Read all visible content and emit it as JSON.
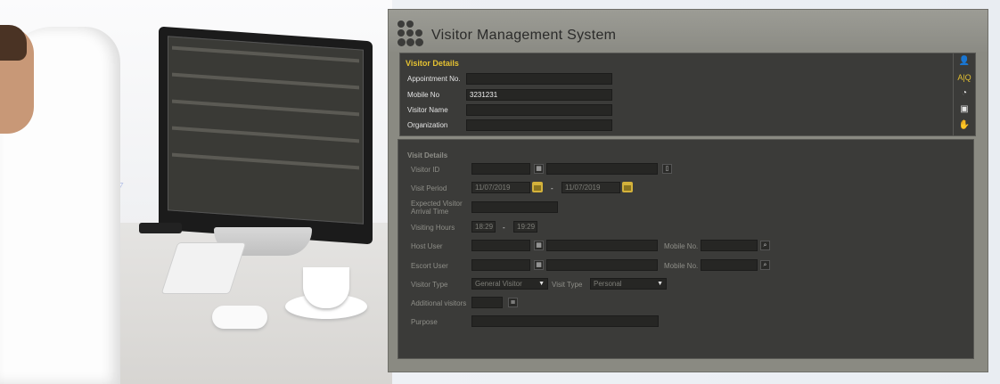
{
  "app": {
    "title": "Visitor Management System"
  },
  "visitor_details": {
    "heading": "Visitor Details",
    "appointment_label": "Appointment No.",
    "appointment_value": "",
    "mobile_label": "Mobile No",
    "mobile_value": "3231231",
    "name_label": "Visitor Name",
    "name_value": "",
    "org_label": "Organization",
    "org_value": ""
  },
  "visit_details": {
    "heading": "Visit Details",
    "visitor_id_label": "Visitor ID",
    "visit_period_label": "Visit Period",
    "period_from": "11/07/2019",
    "period_sep": "-",
    "period_to": "11/07/2019",
    "arrival_label_1": "Expected Visitor",
    "arrival_label_2": "Arrival Time",
    "hours_label": "Visiting Hours",
    "hours_from": "18:29",
    "hours_sep": "-",
    "hours_to": "19:29",
    "host_label": "Host User",
    "host_mobile_label": "Mobile No.",
    "escort_label": "Escort User",
    "escort_mobile_label": "Mobile No.",
    "visitor_type_label": "Visitor Type",
    "visitor_type_value": "General Visitor",
    "visit_type_label": "Visit Type",
    "visit_type_value": "Personal",
    "additional_label": "Additional visitors",
    "purpose_label": "Purpose"
  },
  "side_toolbar": [
    {
      "icon": "user-add-icon",
      "glyph": "👤"
    },
    {
      "icon": "text-search-icon",
      "glyph": "A|Q"
    },
    {
      "icon": "camera-search-icon",
      "glyph": "◔"
    },
    {
      "icon": "id-card-search-icon",
      "glyph": "▣"
    },
    {
      "icon": "hand-icon",
      "glyph": "✋"
    }
  ],
  "colors": {
    "accent": "#e5c232",
    "panel": "#3b3b39",
    "frame": "#8a8a82"
  }
}
